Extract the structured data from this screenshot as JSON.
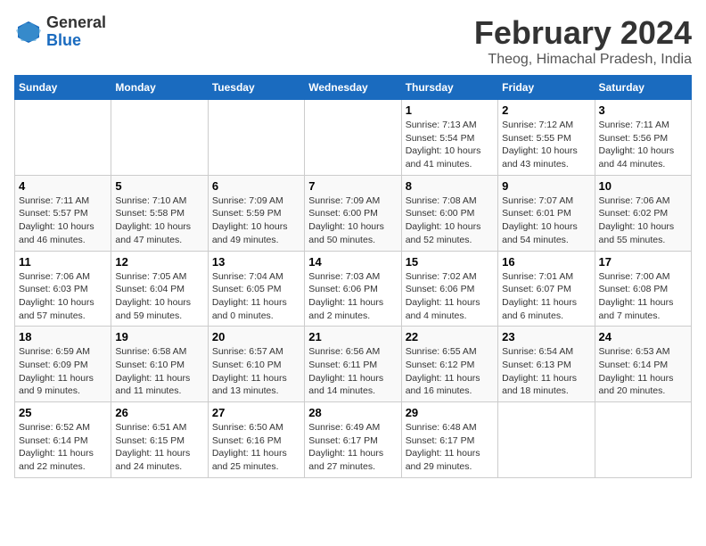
{
  "logo": {
    "general": "General",
    "blue": "Blue"
  },
  "header": {
    "month": "February 2024",
    "location": "Theog, Himachal Pradesh, India"
  },
  "weekdays": [
    "Sunday",
    "Monday",
    "Tuesday",
    "Wednesday",
    "Thursday",
    "Friday",
    "Saturday"
  ],
  "weeks": [
    [
      {
        "day": "",
        "info": ""
      },
      {
        "day": "",
        "info": ""
      },
      {
        "day": "",
        "info": ""
      },
      {
        "day": "",
        "info": ""
      },
      {
        "day": "1",
        "sunrise": "Sunrise: 7:13 AM",
        "sunset": "Sunset: 5:54 PM",
        "daylight": "Daylight: 10 hours and 41 minutes."
      },
      {
        "day": "2",
        "sunrise": "Sunrise: 7:12 AM",
        "sunset": "Sunset: 5:55 PM",
        "daylight": "Daylight: 10 hours and 43 minutes."
      },
      {
        "day": "3",
        "sunrise": "Sunrise: 7:11 AM",
        "sunset": "Sunset: 5:56 PM",
        "daylight": "Daylight: 10 hours and 44 minutes."
      }
    ],
    [
      {
        "day": "4",
        "sunrise": "Sunrise: 7:11 AM",
        "sunset": "Sunset: 5:57 PM",
        "daylight": "Daylight: 10 hours and 46 minutes."
      },
      {
        "day": "5",
        "sunrise": "Sunrise: 7:10 AM",
        "sunset": "Sunset: 5:58 PM",
        "daylight": "Daylight: 10 hours and 47 minutes."
      },
      {
        "day": "6",
        "sunrise": "Sunrise: 7:09 AM",
        "sunset": "Sunset: 5:59 PM",
        "daylight": "Daylight: 10 hours and 49 minutes."
      },
      {
        "day": "7",
        "sunrise": "Sunrise: 7:09 AM",
        "sunset": "Sunset: 6:00 PM",
        "daylight": "Daylight: 10 hours and 50 minutes."
      },
      {
        "day": "8",
        "sunrise": "Sunrise: 7:08 AM",
        "sunset": "Sunset: 6:00 PM",
        "daylight": "Daylight: 10 hours and 52 minutes."
      },
      {
        "day": "9",
        "sunrise": "Sunrise: 7:07 AM",
        "sunset": "Sunset: 6:01 PM",
        "daylight": "Daylight: 10 hours and 54 minutes."
      },
      {
        "day": "10",
        "sunrise": "Sunrise: 7:06 AM",
        "sunset": "Sunset: 6:02 PM",
        "daylight": "Daylight: 10 hours and 55 minutes."
      }
    ],
    [
      {
        "day": "11",
        "sunrise": "Sunrise: 7:06 AM",
        "sunset": "Sunset: 6:03 PM",
        "daylight": "Daylight: 10 hours and 57 minutes."
      },
      {
        "day": "12",
        "sunrise": "Sunrise: 7:05 AM",
        "sunset": "Sunset: 6:04 PM",
        "daylight": "Daylight: 10 hours and 59 minutes."
      },
      {
        "day": "13",
        "sunrise": "Sunrise: 7:04 AM",
        "sunset": "Sunset: 6:05 PM",
        "daylight": "Daylight: 11 hours and 0 minutes."
      },
      {
        "day": "14",
        "sunrise": "Sunrise: 7:03 AM",
        "sunset": "Sunset: 6:06 PM",
        "daylight": "Daylight: 11 hours and 2 minutes."
      },
      {
        "day": "15",
        "sunrise": "Sunrise: 7:02 AM",
        "sunset": "Sunset: 6:06 PM",
        "daylight": "Daylight: 11 hours and 4 minutes."
      },
      {
        "day": "16",
        "sunrise": "Sunrise: 7:01 AM",
        "sunset": "Sunset: 6:07 PM",
        "daylight": "Daylight: 11 hours and 6 minutes."
      },
      {
        "day": "17",
        "sunrise": "Sunrise: 7:00 AM",
        "sunset": "Sunset: 6:08 PM",
        "daylight": "Daylight: 11 hours and 7 minutes."
      }
    ],
    [
      {
        "day": "18",
        "sunrise": "Sunrise: 6:59 AM",
        "sunset": "Sunset: 6:09 PM",
        "daylight": "Daylight: 11 hours and 9 minutes."
      },
      {
        "day": "19",
        "sunrise": "Sunrise: 6:58 AM",
        "sunset": "Sunset: 6:10 PM",
        "daylight": "Daylight: 11 hours and 11 minutes."
      },
      {
        "day": "20",
        "sunrise": "Sunrise: 6:57 AM",
        "sunset": "Sunset: 6:10 PM",
        "daylight": "Daylight: 11 hours and 13 minutes."
      },
      {
        "day": "21",
        "sunrise": "Sunrise: 6:56 AM",
        "sunset": "Sunset: 6:11 PM",
        "daylight": "Daylight: 11 hours and 14 minutes."
      },
      {
        "day": "22",
        "sunrise": "Sunrise: 6:55 AM",
        "sunset": "Sunset: 6:12 PM",
        "daylight": "Daylight: 11 hours and 16 minutes."
      },
      {
        "day": "23",
        "sunrise": "Sunrise: 6:54 AM",
        "sunset": "Sunset: 6:13 PM",
        "daylight": "Daylight: 11 hours and 18 minutes."
      },
      {
        "day": "24",
        "sunrise": "Sunrise: 6:53 AM",
        "sunset": "Sunset: 6:14 PM",
        "daylight": "Daylight: 11 hours and 20 minutes."
      }
    ],
    [
      {
        "day": "25",
        "sunrise": "Sunrise: 6:52 AM",
        "sunset": "Sunset: 6:14 PM",
        "daylight": "Daylight: 11 hours and 22 minutes."
      },
      {
        "day": "26",
        "sunrise": "Sunrise: 6:51 AM",
        "sunset": "Sunset: 6:15 PM",
        "daylight": "Daylight: 11 hours and 24 minutes."
      },
      {
        "day": "27",
        "sunrise": "Sunrise: 6:50 AM",
        "sunset": "Sunset: 6:16 PM",
        "daylight": "Daylight: 11 hours and 25 minutes."
      },
      {
        "day": "28",
        "sunrise": "Sunrise: 6:49 AM",
        "sunset": "Sunset: 6:17 PM",
        "daylight": "Daylight: 11 hours and 27 minutes."
      },
      {
        "day": "29",
        "sunrise": "Sunrise: 6:48 AM",
        "sunset": "Sunset: 6:17 PM",
        "daylight": "Daylight: 11 hours and 29 minutes."
      },
      {
        "day": "",
        "info": ""
      },
      {
        "day": "",
        "info": ""
      }
    ]
  ]
}
